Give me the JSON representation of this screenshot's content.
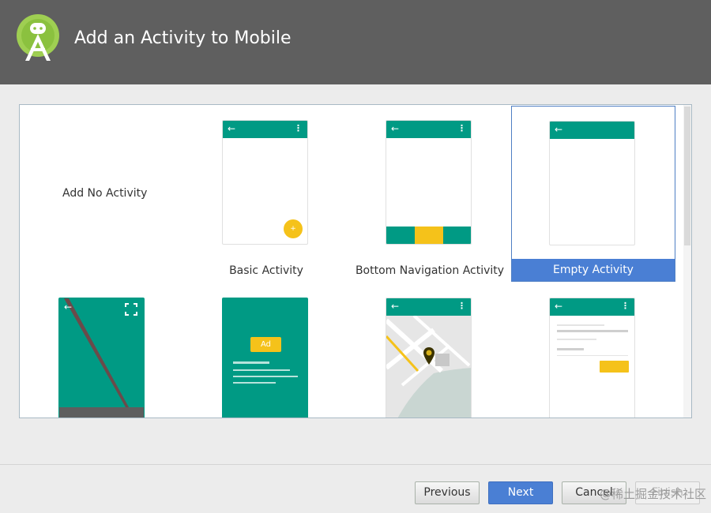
{
  "header": {
    "title": "Add an Activity to Mobile",
    "logo_icon": "android-studio-logo-icon"
  },
  "gallery": {
    "no_activity_label": "Add No Activity",
    "templates": [
      {
        "label": "Basic Activity"
      },
      {
        "label": "Bottom Navigation Activity"
      },
      {
        "label": "Empty Activity",
        "selected": true
      },
      {
        "label": ""
      },
      {
        "label": ""
      },
      {
        "label": ""
      },
      {
        "label": ""
      }
    ],
    "ad_label": "Ad"
  },
  "icons": {
    "back": "←",
    "overflow": "⋮",
    "fullscreen": "fullscreen-icon",
    "map_pin": "map-pin-icon",
    "fab_plus": "+"
  },
  "buttons": {
    "previous": "Previous",
    "next": "Next",
    "cancel": "Cancel",
    "finish": "Finish"
  },
  "watermark": "@稀土掘金技术社区",
  "colors": {
    "teal": "#009a84",
    "accent": "#f5c21a",
    "selection": "#4a7fd4",
    "header": "#5f5f5f"
  }
}
